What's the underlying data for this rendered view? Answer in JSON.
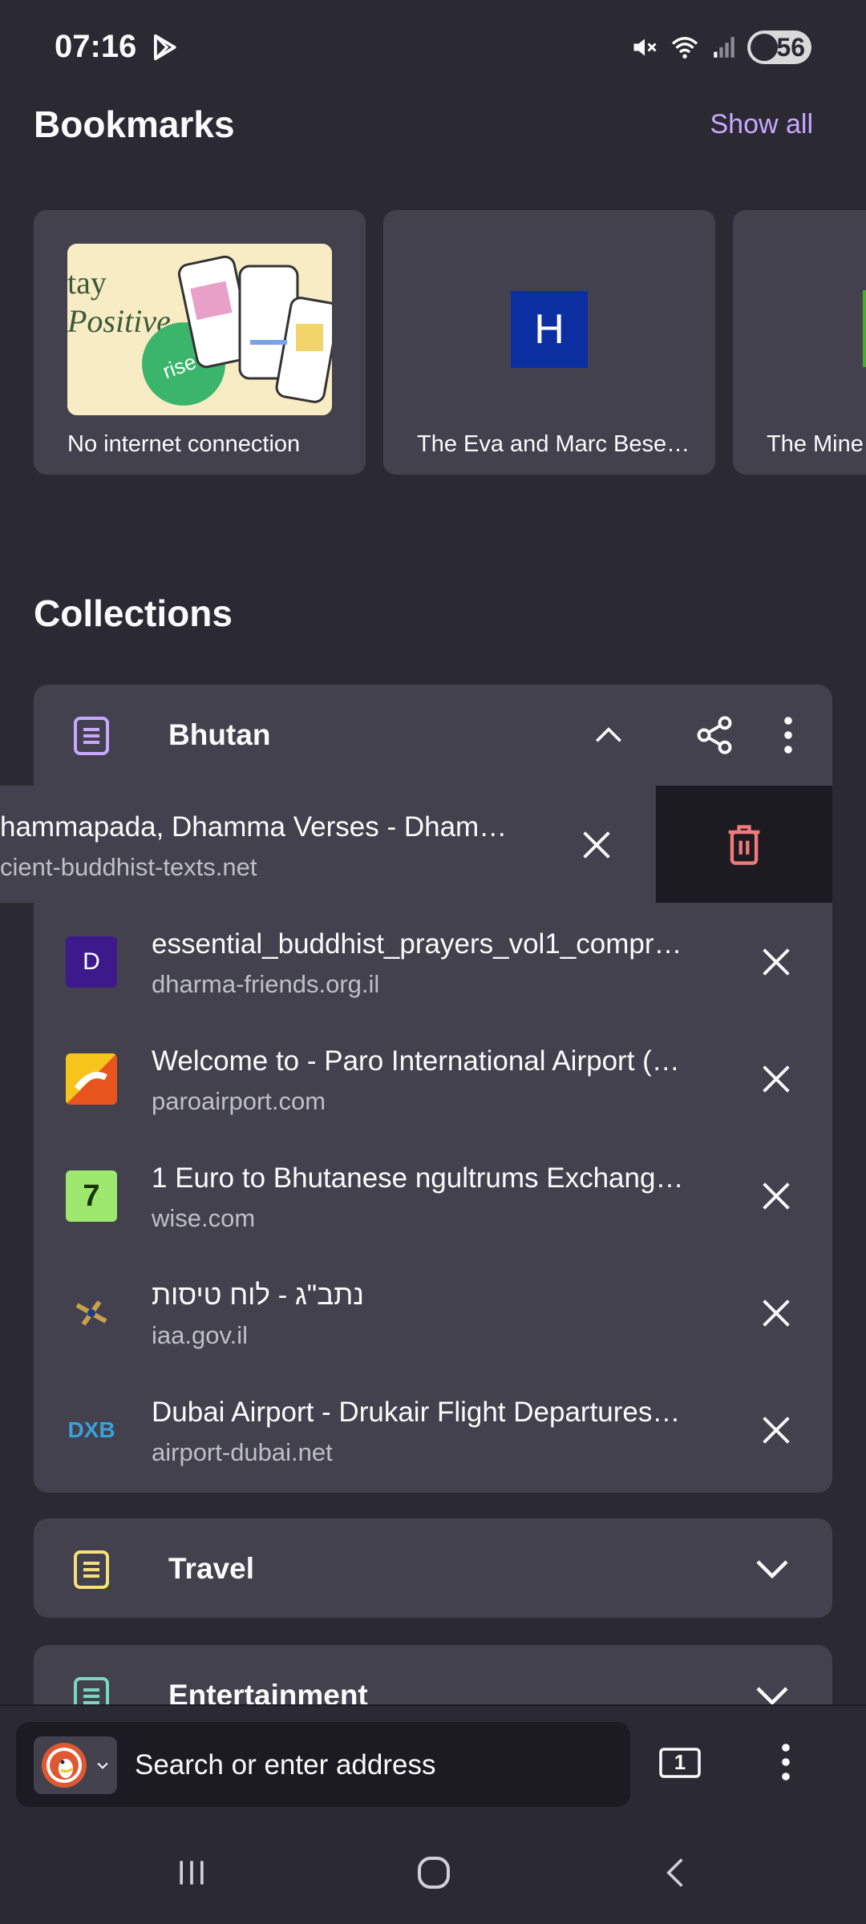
{
  "status": {
    "time": "07:16",
    "battery": "56"
  },
  "bookmarks": {
    "title": "Bookmarks",
    "show_all": "Show all",
    "cards": [
      {
        "label": "No internet connection",
        "thumb_text": "tay Positive",
        "thumb_badge": "riseUP"
      },
      {
        "label": "The Eva and Marc Bese…",
        "letter": "H"
      },
      {
        "label": "The Mine"
      }
    ]
  },
  "collections": {
    "title": "Collections",
    "bhutan": {
      "name": "Bhutan",
      "swiped_item": {
        "title": "hammapada, Dhamma Verses - Dham…",
        "url": "cient-buddhist-texts.net"
      },
      "items": [
        {
          "title": "essential_buddhist_prayers_vol1_compr…",
          "url": "dharma-friends.org.il",
          "fav_text": "D"
        },
        {
          "title": "Welcome to - Paro International Airport (…",
          "url": "paroairport.com",
          "fav_text": ""
        },
        {
          "title": "1 Euro to Bhutanese ngultrums Exchang…",
          "url": "wise.com",
          "fav_text": "7"
        },
        {
          "title": "נתב\"ג - לוח טיסות",
          "url": "iaa.gov.il",
          "fav_text": ""
        },
        {
          "title": "Dubai Airport - Drukair Flight Departures…",
          "url": "airport-dubai.net",
          "fav_text": "DXB"
        }
      ]
    },
    "travel": {
      "name": "Travel"
    },
    "entertainment": {
      "name": "Entertainment"
    }
  },
  "toolbar": {
    "address_placeholder": "Search or enter address",
    "tab_count": "1"
  }
}
